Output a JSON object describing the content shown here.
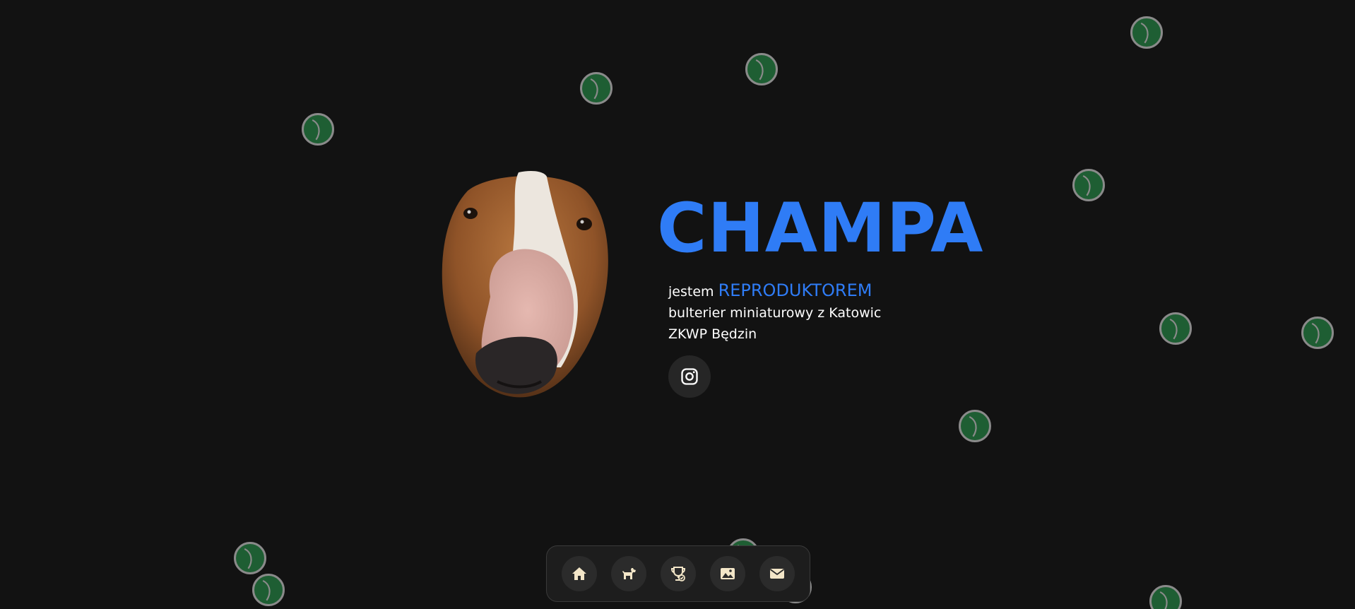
{
  "hero": {
    "name": "CHAMPA",
    "bio_prefix": "jestem",
    "bio_highlight": "REPRODUKTOREM",
    "bio_line2": "bulterier miniaturowy z Katowic",
    "bio_line3": "ZKWP Będzin"
  },
  "social": {
    "instagram_icon": "instagram-icon"
  },
  "dock": {
    "items": [
      {
        "icon": "home-icon"
      },
      {
        "icon": "dog-icon"
      },
      {
        "icon": "trophy-icon"
      },
      {
        "icon": "image-icon"
      },
      {
        "icon": "envelope-icon"
      }
    ]
  },
  "colors": {
    "background": "#121212",
    "accent": "#2f7cf6",
    "ball_green": "#1e5e33",
    "ball_rim": "#8a8a8a",
    "dock_icon": "#f3e6c8"
  }
}
